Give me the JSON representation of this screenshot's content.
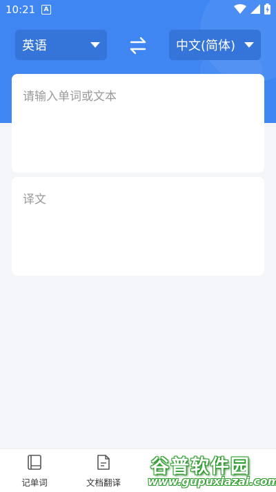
{
  "status_bar": {
    "time": "10:21",
    "notification_icon": "A"
  },
  "language": {
    "source": "英语",
    "target": "中文(简体)"
  },
  "input": {
    "placeholder": "请输入单词或文本"
  },
  "output": {
    "placeholder": "译文"
  },
  "tabs": [
    {
      "label": "记单词",
      "icon": "book-icon"
    },
    {
      "label": "文档翻译",
      "icon": "document-icon"
    }
  ],
  "watermark": {
    "title": "谷普软件园",
    "url": "www.gupuxiazai.com"
  },
  "colors": {
    "accent": "#3f86f3",
    "button": "#3575da",
    "watermark": "#2a9d2a"
  }
}
